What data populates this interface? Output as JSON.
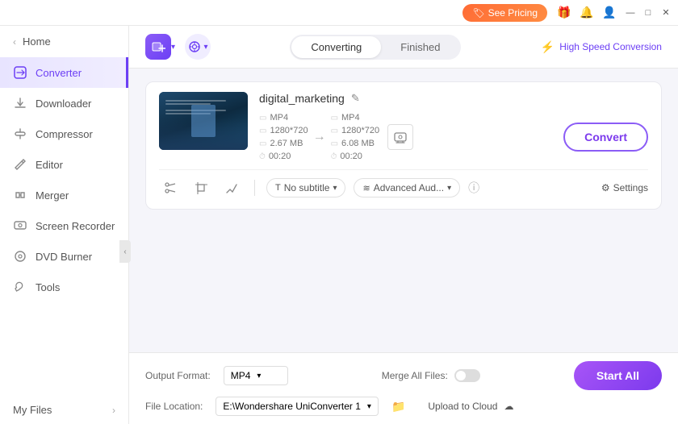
{
  "titleBar": {
    "seePricingLabel": "See Pricing",
    "giftIcon": "🎁",
    "bellIcon": "🔔",
    "userIcon": "👤",
    "minimizeIcon": "—",
    "maximizeIcon": "□",
    "closeIcon": "✕"
  },
  "sidebar": {
    "homeLabel": "Home",
    "items": [
      {
        "id": "converter",
        "label": "Converter",
        "active": true
      },
      {
        "id": "downloader",
        "label": "Downloader",
        "active": false
      },
      {
        "id": "compressor",
        "label": "Compressor",
        "active": false
      },
      {
        "id": "editor",
        "label": "Editor",
        "active": false
      },
      {
        "id": "merger",
        "label": "Merger",
        "active": false
      },
      {
        "id": "screen-recorder",
        "label": "Screen Recorder",
        "active": false
      },
      {
        "id": "dvd-burner",
        "label": "DVD Burner",
        "active": false
      },
      {
        "id": "tools",
        "label": "Tools",
        "active": false
      }
    ],
    "myFilesLabel": "My Files"
  },
  "toolbar": {
    "addFileTooltip": "+",
    "settingsTooltip": "⚙",
    "tabs": [
      {
        "id": "converting",
        "label": "Converting",
        "active": true
      },
      {
        "id": "finished",
        "label": "Finished",
        "active": false
      }
    ],
    "highSpeedLabel": "High Speed Conversion"
  },
  "fileCard": {
    "fileName": "digital_marketing",
    "editIcon": "✎",
    "source": {
      "format": "MP4",
      "resolution": "1280*720",
      "size": "2.67 MB",
      "duration": "00:20"
    },
    "target": {
      "format": "MP4",
      "resolution": "1280*720",
      "size": "6.08 MB",
      "duration": "00:20"
    },
    "convertBtnLabel": "Convert",
    "subtitleLabel": "No subtitle",
    "audioLabel": "Advanced Aud...",
    "settingsLabel": "Settings"
  },
  "bottomBar": {
    "outputFormatLabel": "Output Format:",
    "outputFormatValue": "MP4",
    "fileLocationLabel": "File Location:",
    "fileLocationValue": "E:\\Wondershare UniConverter 1",
    "mergeAllFilesLabel": "Merge All Files:",
    "uploadToCloudLabel": "Upload to Cloud",
    "startAllLabel": "Start All"
  }
}
